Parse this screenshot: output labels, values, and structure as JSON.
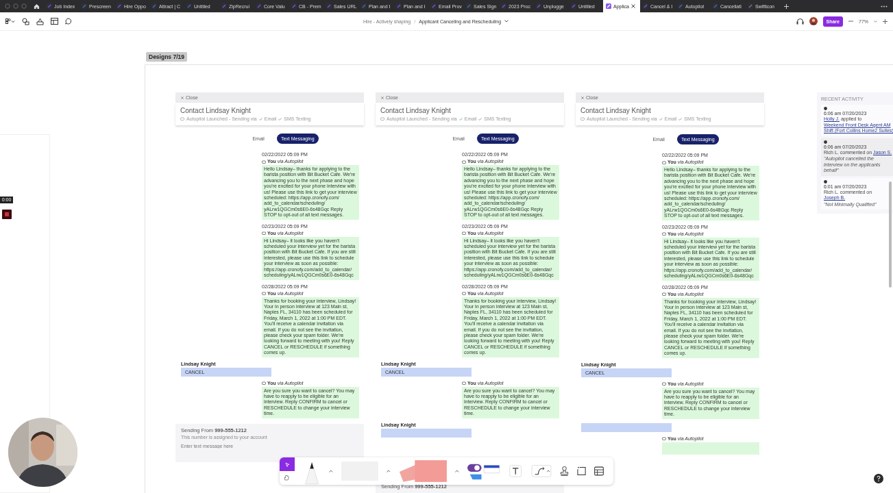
{
  "tabs": [
    {
      "label": "Job Index",
      "kind": "board",
      "selected": false
    },
    {
      "label": "Prescreen",
      "kind": "design",
      "selected": false
    },
    {
      "label": "Hire Oppo",
      "kind": "board",
      "selected": false
    },
    {
      "label": "Attract | C",
      "kind": "design",
      "selected": false
    },
    {
      "label": "Untitled",
      "kind": "design",
      "selected": false
    },
    {
      "label": "ZipRecrui",
      "kind": "board",
      "selected": false
    },
    {
      "label": "Core Valu",
      "kind": "board",
      "selected": false
    },
    {
      "label": "CB - Prem",
      "kind": "board",
      "selected": false
    },
    {
      "label": "Sales URL",
      "kind": "board",
      "selected": false
    },
    {
      "label": "Plan and I",
      "kind": "design",
      "selected": false
    },
    {
      "label": "Plan and I",
      "kind": "board",
      "selected": false
    },
    {
      "label": "Email Prov",
      "kind": "board",
      "selected": false
    },
    {
      "label": "Sales Sign",
      "kind": "design",
      "selected": false
    },
    {
      "label": "2023 Proc",
      "kind": "board",
      "selected": false
    },
    {
      "label": "Unplugge",
      "kind": "board",
      "selected": false
    },
    {
      "label": "Untitled",
      "kind": "board",
      "selected": false
    },
    {
      "label": "Applica",
      "kind": "board",
      "selected": true
    },
    {
      "label": "Cancel & I",
      "kind": "board",
      "selected": false
    },
    {
      "label": "Autopilot",
      "kind": "design",
      "selected": false
    },
    {
      "label": "Cancellati",
      "kind": "design",
      "selected": false
    },
    {
      "label": "Swifticon",
      "kind": "other",
      "selected": false
    }
  ],
  "toolbar": {
    "breadcrumb": [
      "Hire - Actively shaping",
      "Applicant Canceling and Rescheduling"
    ],
    "separator": "/",
    "share": "Share",
    "zoom": "77%"
  },
  "canvas": {
    "section_label": "Designs 7/19",
    "cards": [
      {
        "close": "Close",
        "title": "Contact Lindsay Knight",
        "status": "Autopilot Launched - Sending via",
        "channels": [
          "Email",
          "SMS Texting"
        ],
        "tabs": [
          {
            "label": "Email",
            "selected": false
          },
          {
            "label": "Text Messaging",
            "selected": true
          }
        ],
        "messages": [
          {
            "kind": "outgoing",
            "timestamp": "02/22/2022 05:09 PM",
            "sender": "**You** *via Autopilot*",
            "text": "Hello Lindsay– thanks for applying to the barista position with Bit Bucket Cafe. We're advancing you to the next phase and hope you're excited for your phone interview with us! Please use this link to get your interview scheduled: https://app.cronofy.com/ add_to_calendar/scheduling/ yALrw1QGCm0s6E0-6s48Gqc Reply STOP to opt-out of all text messages."
          },
          {
            "kind": "outgoing",
            "timestamp": "02/23/2022 05:09 PM",
            "sender": "**You** *via Autopilot*",
            "text": "Hi Lindsay– it looks like you haven't scheduled your interview yet for the barista position with Bit Bucket Cafe. If you are still interested, please use this link to schedule your interview as soon as possible: https://app.cronofy.com/add_to_calendar/ scheduling/yALrw1QGCm0s6E0-6s48Gqc"
          },
          {
            "kind": "outgoing",
            "timestamp": "02/28/2022 05:09 PM",
            "sender": "**You** *via Autopilot*",
            "text": "Thanks for booking your interview, Lindsay! Your in person interview at 123 Main st, Naples FL, 34110 has been scheduled for Friday, March 1, 2022 at 1:00 PM EDT. You'll receive a calendar invitation via email. If you do not see the invitation, please check your spam folder. We're looking forward to meeting with you! Reply CANCEL or RESCHEDULE if something comes up."
          },
          {
            "kind": "incoming",
            "sender": "Lindsay Knight",
            "text": "CANCEL"
          },
          {
            "kind": "outgoing",
            "sender": "**You** *via Autopilot*",
            "text": "Are you sure you want to cancel? You may have to reapply to be eligible for an interview. Reply CONFIRM to cancel or RESCHEDULE to change your interview time."
          }
        ],
        "composer": {
          "from": "Sending From **999-555-1212**",
          "note": "This number is assigned to your account",
          "placeholder": "Enter text message here"
        }
      },
      {
        "close": "Close",
        "title": "Contact Lindsay Knight",
        "status": "Autopilot Launched - Sending via",
        "channels": [
          "Email",
          "SMS Texting"
        ],
        "tabs": [
          {
            "label": "Email",
            "selected": false
          },
          {
            "label": "Text Messaging",
            "selected": true
          }
        ],
        "messages": [
          {
            "kind": "outgoing",
            "timestamp": "02/22/2022 05:09 PM",
            "sender": "**You** *via Autopilot*",
            "text": "Hello Lindsay– thanks for applying to the barista position with Bit Bucket Cafe. We're advancing you to the next phase and hope you're excited for your phone interview with us! Please use this link to get your interview scheduled: https://app.cronofy.com/ add_to_calendar/scheduling/ yALrw1QGCm0s6E0-6s48Gqc Reply STOP to opt-out of all text messages."
          },
          {
            "kind": "outgoing",
            "timestamp": "02/23/2022 05:09 PM",
            "sender": "**You** *via Autopilot*",
            "text": "Hi Lindsay– it looks like you haven't scheduled your interview yet for the barista position with Bit Bucket Cafe. If you are still interested, please use this link to schedule your interview as soon as possible: https://app.cronofy.com/add_to_calendar/ scheduling/yALrw1QGCm0s6E0-6s48Gqc"
          },
          {
            "kind": "outgoing",
            "timestamp": "02/28/2022 05:09 PM",
            "sender": "**You** *via Autopilot*",
            "text": "Thanks for booking your interview, Lindsay! Your in person interview at 123 Main st, Naples FL, 34110 has been scheduled for Friday, March 1, 2022 at 1:00 PM EDT. You'll receive a calendar invitation via email. If you do not see the invitation, please check your spam folder. We're looking forward to meeting with you! Reply CANCEL or RESCHEDULE if something comes up."
          },
          {
            "kind": "incoming",
            "sender": "Lindsay Knight",
            "text": "CANCEL"
          },
          {
            "kind": "outgoing",
            "sender": "**You** *via Autopilot*",
            "text": "Are you sure you want to cancel? You may have to reapply to be eligible for an interview. Reply CONFIRM to cancel or RESCHEDULE to change your interview time."
          },
          {
            "kind": "incoming",
            "sender": "Lindsay Knight"
          }
        ],
        "composer": {
          "from": "Sending From **999-555-1212**"
        }
      },
      {
        "close": "Close",
        "title": "Contact Lindsay Knight",
        "status": "Autopilot Launched - Sending via",
        "channels": [
          "Email",
          "SMS Texting"
        ],
        "tabs": [
          {
            "label": "Email",
            "selected": false
          },
          {
            "label": "Text Messaging",
            "selected": true
          }
        ],
        "messages": [
          {
            "kind": "outgoing",
            "timestamp": "02/22/2022 05:09 PM",
            "sender": "**You** *via Autopilot*",
            "text": "Hello Lindsay– thanks for applying to the barista position with Bit Bucket Cafe. We're advancing you to the next phase and hope you're excited for your phone interview with us! Please use this link to get your interview scheduled: https://app.cronofy.com/ add_to_calendar/scheduling/ yALrw1QGCm0s6E0-6s48Gqc Reply STOP to opt-out of all text messages."
          },
          {
            "kind": "outgoing",
            "timestamp": "02/23/2022 05:09 PM",
            "sender": "**You** *via Autopilot*",
            "text": "Hi Lindsay– it looks like you haven't scheduled your interview yet for the barista position with Bit Bucket Cafe. If you are still interested, please use this link to schedule your interview as soon as possible: https://app.cronofy.com/add_to_calendar/ scheduling/yALrw1QGCm0s6E0-6s48Gqc"
          },
          {
            "kind": "outgoing",
            "timestamp": "02/28/2022 05:09 PM",
            "sender": "**You** *via Autopilot*",
            "text": "Thanks for booking your interview, Lindsay! Your in person interview at 123 Main st, Naples FL, 34110 has been scheduled for Friday, March 1, 2022 at 1:00 PM EDT. You'll receive a calendar invitation via email. If you do not see the invitation, please check your spam folder. We're looking forward to meeting with you! Reply CANCEL or RESCHEDULE if something comes up."
          },
          {
            "kind": "incoming",
            "sender": "Lindsay Knight",
            "text": "CANCEL"
          },
          {
            "kind": "outgoing",
            "sender": "**You** *via Autopilot*",
            "text": "Are you sure you want to cancel? You may have to reapply to be eligible for an interview. Reply CONFIRM to cancel or RESCHEDULE to change your interview time."
          },
          {
            "kind": "incoming"
          },
          {
            "kind": "outgoing",
            "sender": "**You** *via Autopilot*"
          }
        ]
      }
    ]
  },
  "activity": {
    "heading": "RECENT ACTIVITY",
    "items": [
      {
        "time": "6:06 am 07/20/2023",
        "actor": "Holly J.",
        "actor_link": true,
        "action": "applied to",
        "target": "Weekend Front Desk Agent AM Shift (Fort Collins Home2 Suites)"
      },
      {
        "time": "6:06 am 07/20/2023",
        "actor": "Rich L.",
        "actor_link": false,
        "action": "commented on",
        "target": "Jason S.",
        "quote": "\"Autopilot cancelled the interview on the applicants behalf\""
      },
      {
        "time": "6:01 am 07/20/2023",
        "actor": "Rich L.",
        "actor_link": false,
        "action": "commented on",
        "target": "Joseph B.",
        "quote": "\"Not Minimally Qualified\""
      }
    ]
  },
  "recording": {
    "timer": "0:00"
  }
}
